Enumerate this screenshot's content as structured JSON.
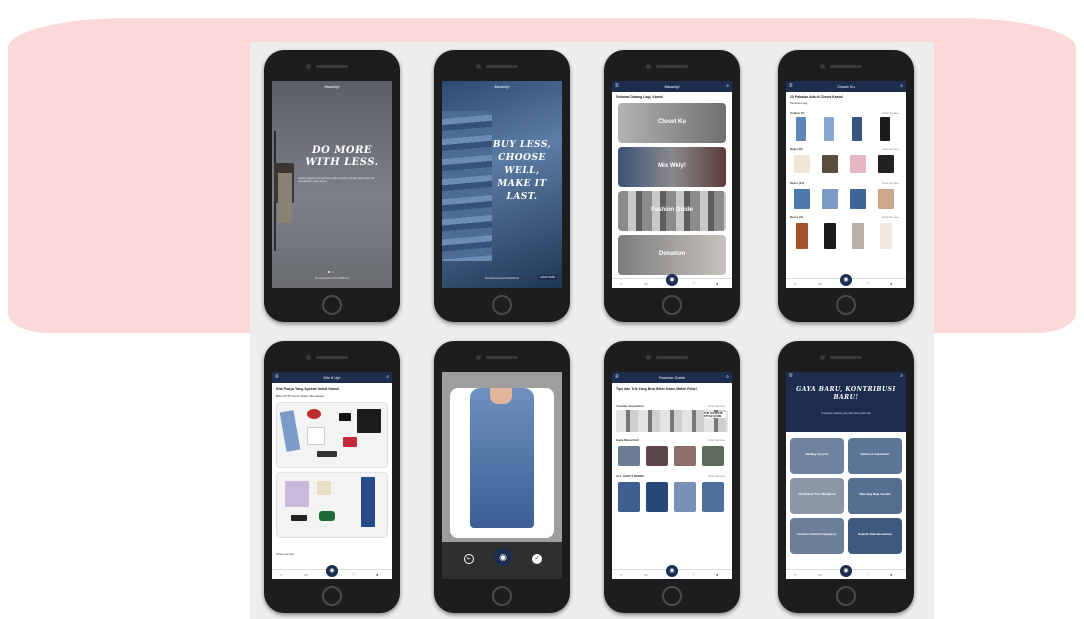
{
  "screens": {
    "s1": {
      "app": "Ittwardy!",
      "headline": "DO MORE WITH LESS.",
      "tagline": "Jadikan pakaian di closet kamu lebih bermakna dengan style simple dan berkelanjutan untuk semua.",
      "footer": "#SustainableFashionBeBetter"
    },
    "s2": {
      "app": "Ittwardy!",
      "headline": "BUY LESS, CHOOSE WELL, MAKE IT LAST.",
      "footer": "#SustainableFashionBeBetter",
      "skip": "LANJUTKAN"
    },
    "s3": {
      "app": "Ittwardy!",
      "greeting": "Selamat Datang Lagi, Kamu!",
      "menu": [
        "Closet Ku",
        "Mix Wkly!",
        "Fashion Guide",
        "Donation"
      ]
    },
    "s4": {
      "title": "Closet Ku",
      "heading": "20 Pakaian Ada di Closet Kamu!",
      "sub": "Tambah Lagi",
      "sections": [
        "Celana (7)",
        "Baju (10)",
        "Outer (11)",
        "Dress (3)"
      ],
      "lihat": "Lihat Semua"
    },
    "s5": {
      "title": "Mix It Up!",
      "heading": "Kita Punya Yang Spesial Untuk Kamu!",
      "sub": "Bisa OOTD Kamu Makin Bervariasi!",
      "footer": "Lihat Lainnya"
    },
    "s6": {
      "label": "Camera"
    },
    "s7": {
      "title": "Fashion Guide",
      "heading": "Tips dan Trik Yang Bisa Bikin Kamu Makin Pede!",
      "sections": [
        "Youtube Inspiration",
        "Gaya Masa Kini!",
        "ALL ABOUT DENIM"
      ],
      "lihat": "Lihat Semua",
      "yt_tag": "THE ULTIMATE STYLE GUIDE"
    },
    "s8": {
      "headline": "GAYA BARU, KONTRIBUSI BARU!",
      "sub": "Donasikan pakaian yang tidak kamu pakai lagi",
      "tiles": [
        "Sewing Upcycle",
        "Before & Inspiration",
        "Pindahkan Tren Mendunia",
        "Rancang Baju Sendiri",
        "Fashion Sustain Kampanye",
        "Sejarah Kain Nusantara"
      ]
    }
  },
  "colors": {
    "navy": "#1c2d4f",
    "pink": "#fbd9d9",
    "phone": "#1d1d1f"
  }
}
